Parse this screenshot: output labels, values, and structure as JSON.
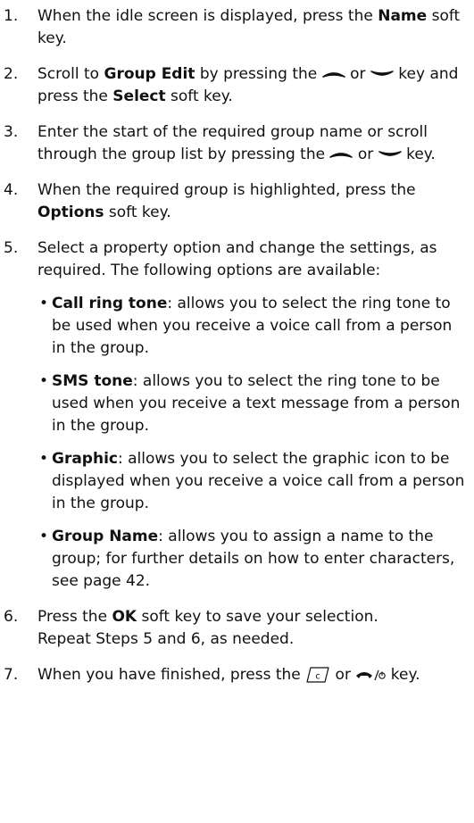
{
  "steps": [
    {
      "num": "1.",
      "a": "When the idle screen is displayed, press the ",
      "b": "Name",
      "c": " soft key."
    },
    {
      "num": "2.",
      "a": "Scroll to ",
      "b": "Group Edit",
      "c": " by pressing the ",
      "d": " or ",
      "e": " key and press the ",
      "f": "Select",
      "g": " soft key."
    },
    {
      "num": "3.",
      "a": "Enter the start of the required group name or scroll through the group list by pressing the ",
      "b": " or ",
      "c": " key."
    },
    {
      "num": "4.",
      "a": "When the required group is highlighted, press the ",
      "b": "Options",
      "c": " soft key."
    },
    {
      "num": "5.",
      "a": "Select a property option and change the settings, as required. The following options are available:",
      "bullets": [
        {
          "term": "Call ring tone",
          "text": ": allows you to select the ring tone to be used when you receive a voice call from a person in the group."
        },
        {
          "term": "SMS tone",
          "text": ": allows you to select the ring tone to be used when you receive a text message from a person in the group."
        },
        {
          "term": "Graphic",
          "text": ": allows you to select the graphic icon to be displayed when you receive a voice call from a person in the group."
        },
        {
          "term": "Group Name",
          "text": ": allows you to assign a name to the group; for further details on how to enter characters, see page 42."
        }
      ]
    },
    {
      "num": "6.",
      "a": "Press the ",
      "b": "OK",
      "c": " soft key to save your selection.",
      "sub": "Repeat Steps 5 and 6, as needed."
    },
    {
      "num": "7.",
      "a": "When you have finished, press the ",
      "b": " or ",
      "c": " key."
    }
  ],
  "icons": {
    "up": "scroll-up-key-icon",
    "down": "scroll-down-key-icon",
    "clear": "clear-key-icon",
    "end": "end-power-key-icon"
  }
}
